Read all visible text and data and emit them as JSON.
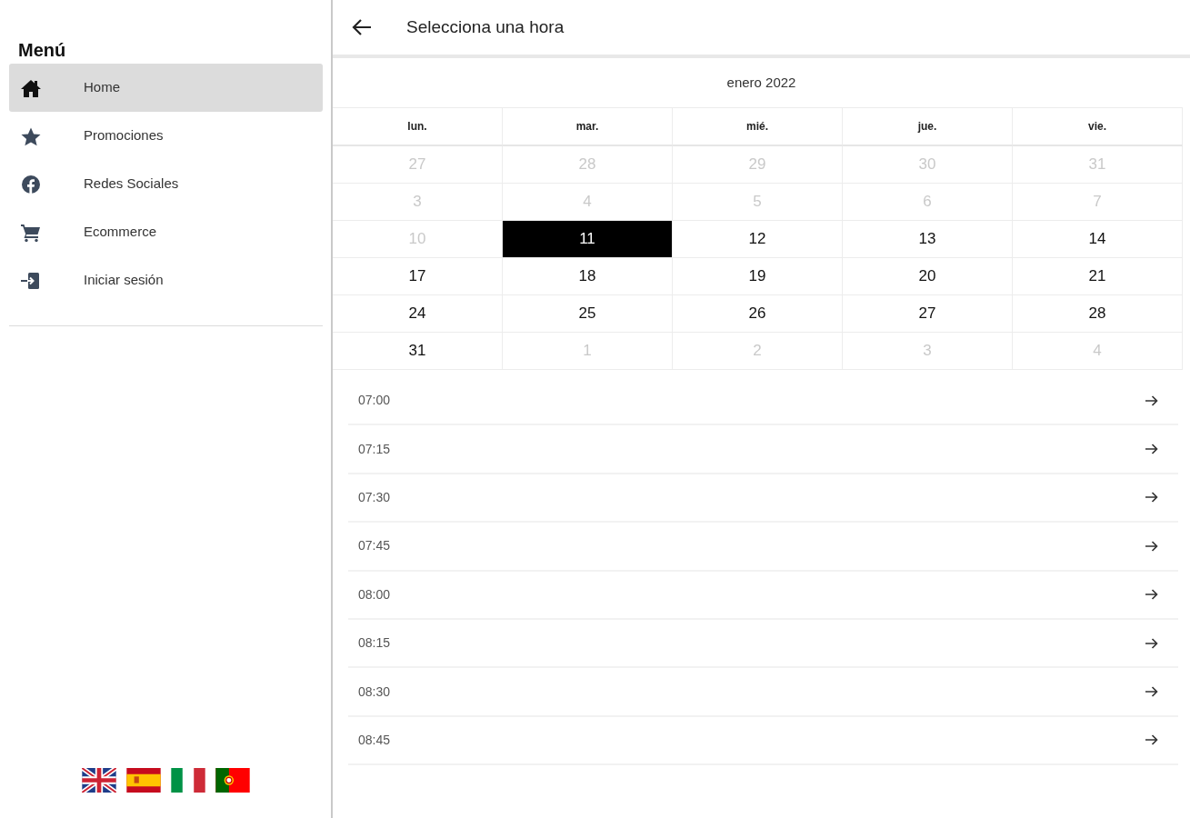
{
  "sidebar": {
    "title": "Menú",
    "items": [
      {
        "label": "Home",
        "selected": true
      },
      {
        "label": "Promociones",
        "selected": false
      },
      {
        "label": "Redes Sociales",
        "selected": false
      },
      {
        "label": "Ecommerce",
        "selected": false
      },
      {
        "label": "Iniciar sesión",
        "selected": false
      }
    ]
  },
  "header": {
    "title": "Selecciona una hora"
  },
  "calendar": {
    "month": "enero 2022",
    "weekdays": [
      "lun.",
      "mar.",
      "mié.",
      "jue.",
      "vie."
    ],
    "weeks": [
      [
        {
          "day": "27",
          "disabled": true,
          "selected": false
        },
        {
          "day": "28",
          "disabled": true,
          "selected": false
        },
        {
          "day": "29",
          "disabled": true,
          "selected": false
        },
        {
          "day": "30",
          "disabled": true,
          "selected": false
        },
        {
          "day": "31",
          "disabled": true,
          "selected": false
        }
      ],
      [
        {
          "day": "3",
          "disabled": true,
          "selected": false
        },
        {
          "day": "4",
          "disabled": true,
          "selected": false
        },
        {
          "day": "5",
          "disabled": true,
          "selected": false
        },
        {
          "day": "6",
          "disabled": true,
          "selected": false
        },
        {
          "day": "7",
          "disabled": true,
          "selected": false
        }
      ],
      [
        {
          "day": "10",
          "disabled": true,
          "selected": false
        },
        {
          "day": "11",
          "disabled": false,
          "selected": true
        },
        {
          "day": "12",
          "disabled": false,
          "selected": false
        },
        {
          "day": "13",
          "disabled": false,
          "selected": false
        },
        {
          "day": "14",
          "disabled": false,
          "selected": false
        }
      ],
      [
        {
          "day": "17",
          "disabled": false,
          "selected": false
        },
        {
          "day": "18",
          "disabled": false,
          "selected": false
        },
        {
          "day": "19",
          "disabled": false,
          "selected": false
        },
        {
          "day": "20",
          "disabled": false,
          "selected": false
        },
        {
          "day": "21",
          "disabled": false,
          "selected": false
        }
      ],
      [
        {
          "day": "24",
          "disabled": false,
          "selected": false
        },
        {
          "day": "25",
          "disabled": false,
          "selected": false
        },
        {
          "day": "26",
          "disabled": false,
          "selected": false
        },
        {
          "day": "27",
          "disabled": false,
          "selected": false
        },
        {
          "day": "28",
          "disabled": false,
          "selected": false
        }
      ],
      [
        {
          "day": "31",
          "disabled": false,
          "selected": false
        },
        {
          "day": "1",
          "disabled": true,
          "selected": false
        },
        {
          "day": "2",
          "disabled": true,
          "selected": false
        },
        {
          "day": "3",
          "disabled": true,
          "selected": false
        },
        {
          "day": "4",
          "disabled": true,
          "selected": false
        }
      ]
    ]
  },
  "time_slots": [
    "07:00",
    "07:15",
    "07:30",
    "07:45",
    "08:00",
    "08:15",
    "08:30",
    "08:45"
  ]
}
